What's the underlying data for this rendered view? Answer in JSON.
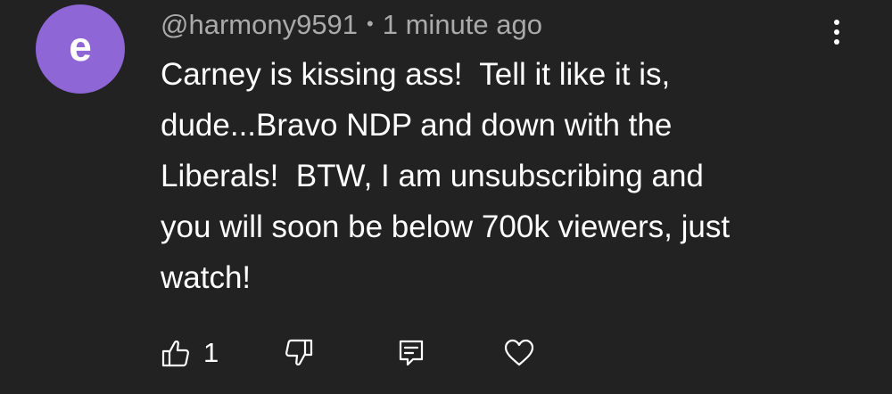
{
  "comment": {
    "avatar_initial": "e",
    "avatar_color": "#8e66d6",
    "username": "@harmony9591",
    "separator": "•",
    "timestamp": "1 minute ago",
    "text": "Carney is kissing ass!  Tell it like it is,\ndude...Bravo NDP and down with the\nLiberals!  BTW, I am unsubscribing and\nyou will soon be below 700k viewers, just\nwatch!",
    "like_count": "1"
  },
  "icons": {
    "like": "thumbs-up-icon",
    "dislike": "thumbs-down-icon",
    "reply": "reply-comment-icon",
    "heart": "heart-icon",
    "more": "more-vertical-icon"
  },
  "colors": {
    "background": "#222222",
    "text": "#ffffff",
    "meta_text": "#aaaaaa"
  }
}
